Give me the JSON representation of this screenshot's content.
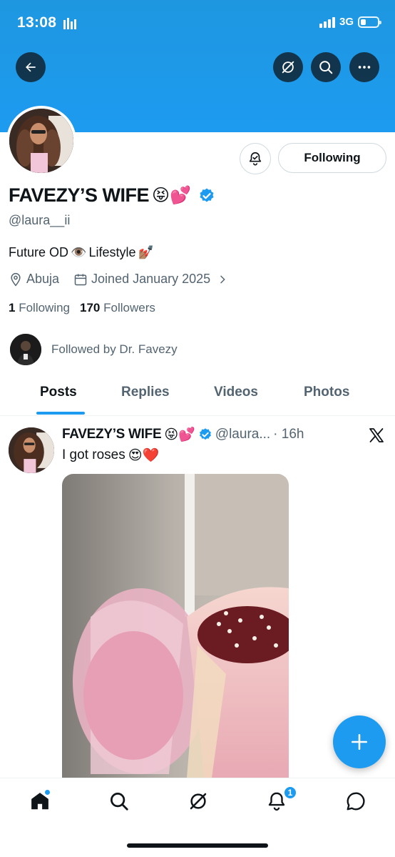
{
  "status_bar": {
    "time": "13:08",
    "network": "3G",
    "battery_level": 0.3
  },
  "profile": {
    "display_name": "FAVEZY’S WIFE",
    "name_emojis": "😝💕",
    "handle": "@laura__ii",
    "bio_text_1": "Future OD",
    "bio_emoji_1": "👁️",
    "bio_text_2": "Lifestyle",
    "bio_emoji_2": "💅🏽",
    "location": "Abuja",
    "joined": "Joined January 2025",
    "following_count": "1",
    "following_label": "Following",
    "followers_count": "170",
    "followers_label": "Followers",
    "followed_by": "Followed by Dr. Favezy"
  },
  "actions": {
    "following_button": "Following"
  },
  "tabs": [
    {
      "label": "Posts",
      "active": true
    },
    {
      "label": "Replies",
      "active": false
    },
    {
      "label": "Videos",
      "active": false
    },
    {
      "label": "Photos",
      "active": false
    }
  ],
  "post": {
    "name": "FAVEZY’S WIFE",
    "name_emojis": "😝💕",
    "handle": "@laura...",
    "time": "· 16h",
    "text": "I got roses",
    "text_emojis": "😍❤️"
  },
  "bottom_nav": {
    "notifications_badge": "1"
  },
  "colors": {
    "accent": "#1d9bf0",
    "text": "#0f1419",
    "secondary_text": "#536471"
  },
  "icons": [
    "back-arrow-icon",
    "grok-icon",
    "search-icon",
    "more-icon",
    "notification-settings-icon",
    "verified-badge-icon",
    "location-icon",
    "calendar-icon",
    "chevron-right-icon",
    "x-logo-icon",
    "compose-plus-icon",
    "home-icon",
    "bell-icon",
    "messages-icon"
  ]
}
